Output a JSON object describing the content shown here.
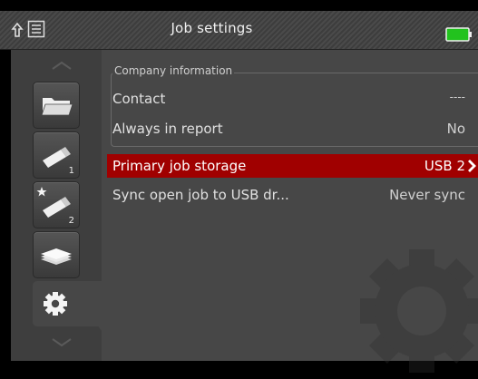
{
  "header": {
    "title": "Job settings",
    "back_icon": "up-arrow-icon",
    "list_icon": "list-icon",
    "battery_icon": "battery-icon",
    "battery_color": "#22c21e"
  },
  "sidebar": {
    "items": [
      {
        "icon": "folder-icon",
        "label": ""
      },
      {
        "icon": "usb-drive-icon",
        "label": "1"
      },
      {
        "icon": "usb-drive-star-icon",
        "label": "2"
      },
      {
        "icon": "paper-stack-icon",
        "label": ""
      },
      {
        "icon": "gear-icon",
        "label": ""
      }
    ]
  },
  "settings": {
    "group_title": "Company information",
    "contact_label": "Contact",
    "contact_value": "----",
    "always_label": "Always in report",
    "always_value": "No",
    "primary_label": "Primary job storage",
    "primary_value": "USB 2",
    "sync_label": "Sync open job to USB dr...",
    "sync_value": "Never sync"
  },
  "colors": {
    "selected_row": "#a00000",
    "background": "#474747"
  }
}
